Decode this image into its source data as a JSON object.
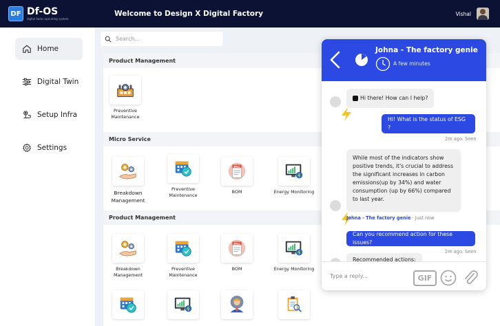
{
  "header": {
    "logo_badge": "DF",
    "logo_name": "Df-OS",
    "logo_tagline": "digital twins operating system",
    "welcome": "Welcome to Design X Digital Factory",
    "user_name": "Vishal"
  },
  "sidebar": {
    "items": [
      {
        "label": "Home",
        "icon": "home-icon"
      },
      {
        "label": "Digital Twin",
        "icon": "sliders-icon"
      },
      {
        "label": "Setup Infra",
        "icon": "infra-icon"
      },
      {
        "label": "Settings",
        "icon": "gear-icon"
      }
    ]
  },
  "search": {
    "placeholder": "Search..."
  },
  "sections": [
    {
      "title": "Product Management",
      "tiles": [
        {
          "label": "Preventive Maintenance",
          "icon": "factory-gear-icon"
        }
      ]
    },
    {
      "title": "Micro Service",
      "tiles": [
        {
          "label": "Breakdown Management",
          "icon": "hand-gears-icon"
        },
        {
          "label": "Preventive Maintenance",
          "icon": "calendar-gear-icon"
        },
        {
          "label": "BOM",
          "icon": "bill-icon"
        },
        {
          "label": "Energy Monitoring",
          "icon": "monitor-chart-icon"
        }
      ]
    },
    {
      "title": "Product Management",
      "tiles": [
        {
          "label": "Breakdown Management",
          "icon": "hand-gears-icon"
        },
        {
          "label": "Preventive Maintenance",
          "icon": "calendar-gear-icon"
        },
        {
          "label": "BOM",
          "icon": "bill-icon"
        },
        {
          "label": "Energy Monitoring",
          "icon": "monitor-chart-icon"
        },
        {
          "label": "",
          "icon": "calendar-gear-icon"
        },
        {
          "label": "",
          "icon": "monitor-chart-icon"
        },
        {
          "label": "",
          "icon": "worker-gear-icon"
        },
        {
          "label": "",
          "icon": "clipboard-search-icon"
        }
      ]
    }
  ],
  "chat": {
    "title": "Johna - The factory genie",
    "subtitle": "A few minutes",
    "messages": [
      {
        "from": "bot",
        "text": "Hi there! How can I help?"
      },
      {
        "from": "user",
        "text": "Hi! What is the status of ESG ?",
        "meta": "2m ago. Seen"
      },
      {
        "from": "bot",
        "text": "While most of the indicators show positive trends, it's crucial to address the significant increases in carbon emissions(up by 34%) and water consumption (up by 66%) compared to last year.",
        "sender": "Johna - The factory genie",
        "meta": "Just now"
      },
      {
        "from": "user",
        "text": "Can you recommend action for these issues?",
        "meta": "2m ago. Seen"
      },
      {
        "from": "bot",
        "text": "Recommended actions:"
      }
    ],
    "reply_placeholder": "Type a reply...",
    "gif_label": "GIF"
  },
  "colors": {
    "topbar": "#0b1233",
    "accent": "#2c49e3",
    "bolt": "#f5c518"
  }
}
